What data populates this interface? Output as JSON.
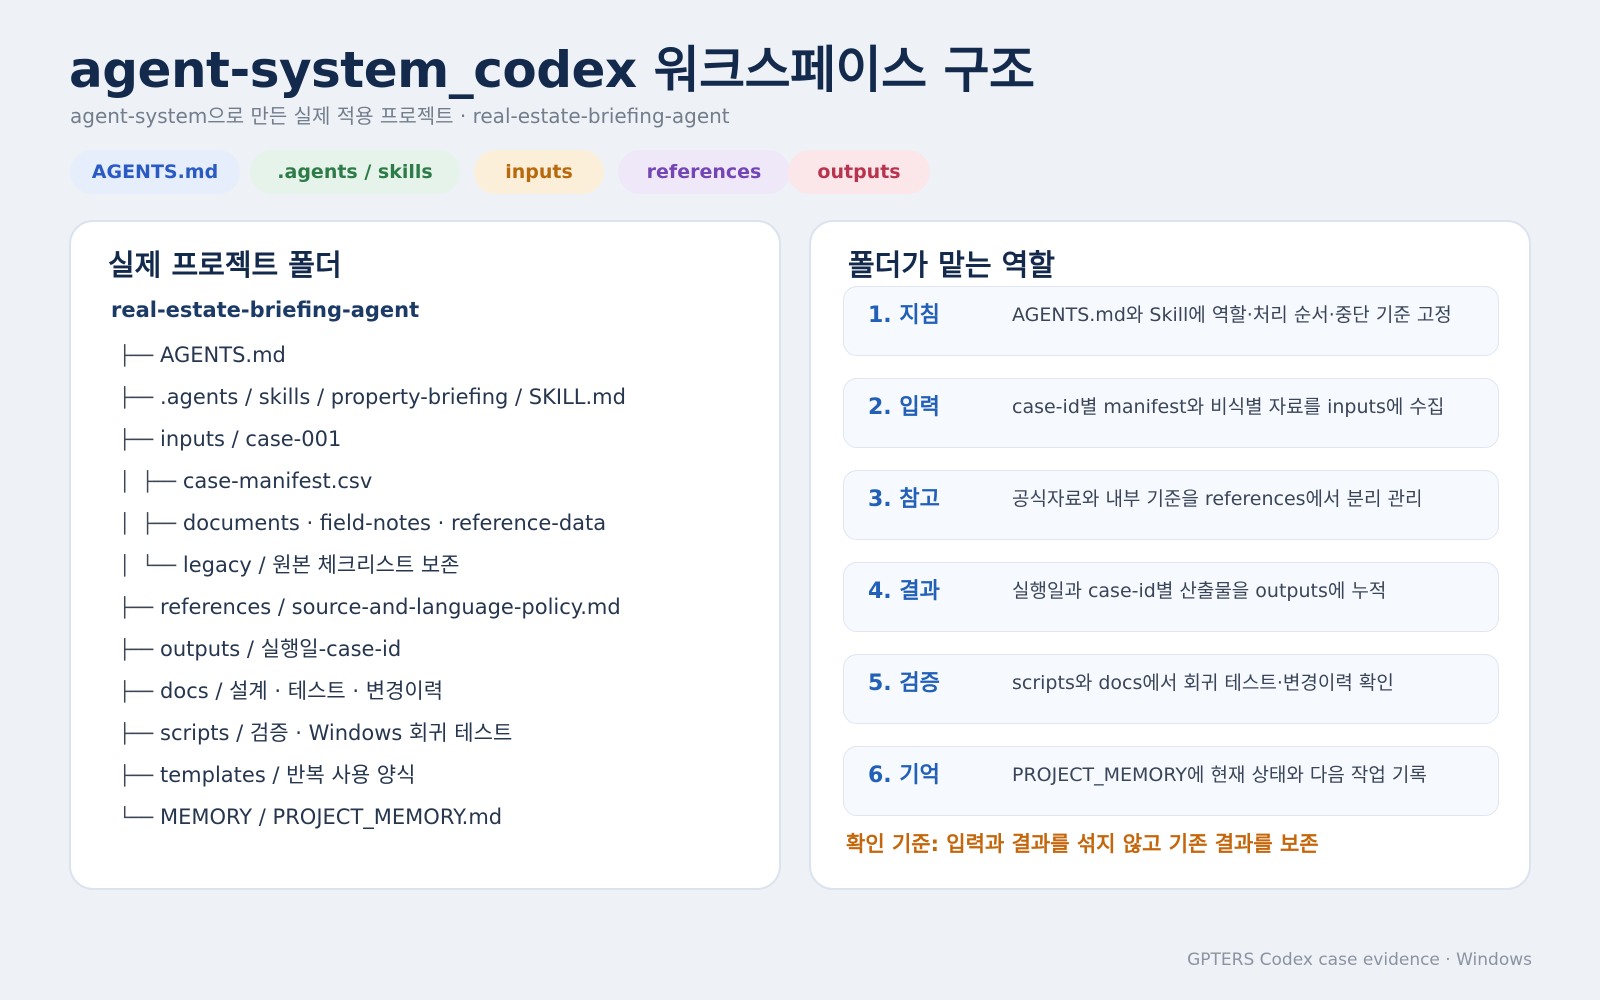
{
  "header": {
    "title": "agent-system_codex 워크스페이스 구조",
    "subtitle": "agent-system으로 만든 실제 적용 프로젝트 · real-estate-briefing-agent"
  },
  "pills": {
    "agents": "AGENTS.md",
    "skills": ".agents / skills",
    "inputs": "inputs",
    "references": "references",
    "outputs": "outputs"
  },
  "left_panel": {
    "title": "실제 프로젝트 폴더",
    "root": "real-estate-briefing-agent",
    "tree": [
      {
        "prefix": "├──",
        "label": "AGENTS.md"
      },
      {
        "prefix": "├──",
        "label": ".agents / skills / property-briefing / SKILL.md"
      },
      {
        "prefix": "├──",
        "label": "inputs / case-001"
      },
      {
        "prefix": "│   ├──",
        "label": "case-manifest.csv"
      },
      {
        "prefix": "│   ├──",
        "label": "documents · field-notes · reference-data"
      },
      {
        "prefix": "│   └──",
        "label": "legacy / 원본 체크리스트 보존"
      },
      {
        "prefix": "├──",
        "label": "references / source-and-language-policy.md"
      },
      {
        "prefix": "├──",
        "label": "outputs / 실행일-case-id"
      },
      {
        "prefix": "├──",
        "label": "docs / 설계 · 테스트 · 변경이력"
      },
      {
        "prefix": "├──",
        "label": "scripts / 검증 · Windows 회귀 테스트"
      },
      {
        "prefix": "├──",
        "label": "templates / 반복 사용 양식"
      },
      {
        "prefix": "└──",
        "label": "MEMORY / PROJECT_MEMORY.md"
      }
    ]
  },
  "right_panel": {
    "title": "폴더가 맡는 역할",
    "roles": [
      {
        "num": "1. 지침",
        "desc": "AGENTS.md와 Skill에 역할·처리 순서·중단 기준 고정"
      },
      {
        "num": "2. 입력",
        "desc": "case-id별 manifest와 비식별 자료를 inputs에 수집"
      },
      {
        "num": "3. 참고",
        "desc": "공식자료와 내부 기준을 references에서 분리 관리"
      },
      {
        "num": "4. 결과",
        "desc": "실행일과 case-id별 산출물을 outputs에 누적"
      },
      {
        "num": "5. 검증",
        "desc": "scripts와 docs에서 회귀 테스트·변경이력 확인"
      },
      {
        "num": "6. 기억",
        "desc": "PROJECT_MEMORY에 현재 상태와 다음 작업 기록"
      }
    ],
    "criterion": "확인 기준: 입력과 결과를 섞지 않고 기존 결과를 보존"
  },
  "footer": "GPTERS Codex case evidence · Windows",
  "colors": {
    "title": "#132a4d",
    "role_number": "#2260b8",
    "criterion": "#c4670c"
  }
}
